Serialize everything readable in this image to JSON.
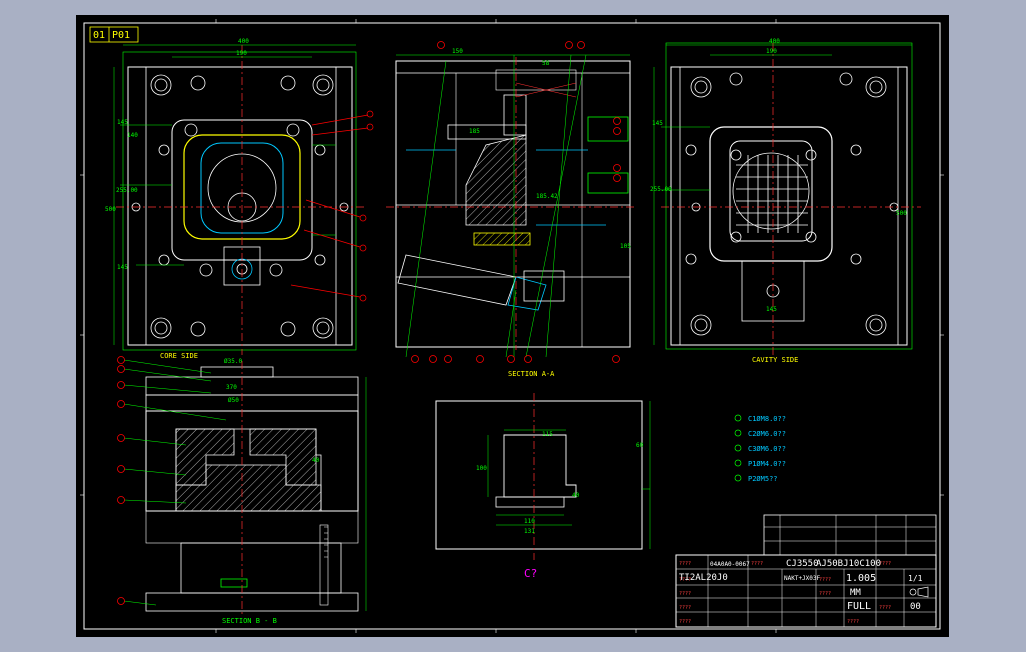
{
  "sheet": {
    "sheet_no": "01",
    "part_code": "P01"
  },
  "views": {
    "core_side": "CORE SIDE",
    "section_aa": "SECTION A-A",
    "cavity_side": "CAVITY SIDE",
    "section_bb": "SECTION B - B",
    "view_c": "C?"
  },
  "legend": [
    "C1ØM8.0??",
    "C2ØM6.0??",
    "C3ØM6.0??",
    "P1ØM4.0??",
    "P2ØM5??"
  ],
  "dimensions": {
    "core_width": "400",
    "core_half": "190",
    "core_left_a": "145",
    "core_left_b": "140",
    "core_center": "255.00",
    "core_height": "500",
    "core_low": "145",
    "aa_top": "150",
    "aa_mid": "185",
    "aa_slide": "185.42",
    "aa_a": "58",
    "aa_b": "105",
    "cavity_width": "400",
    "cavity_half": "190",
    "cavity_left": "145",
    "cavity_center": "255.00",
    "cavity_height": "500",
    "cavity_low": "145",
    "bb_top": "Ø35.0",
    "bb_mid": "Ø50",
    "bb_len": "370",
    "bb_side": "40",
    "c_width": "115",
    "c_height": "100",
    "c_a": "110",
    "c_b": "131",
    "c_c": "60",
    "c_d": "40"
  },
  "title_block": {
    "project_no": "CJ3550",
    "mold_no": "AJ50BJ10C100",
    "part_no": "04A0A0-0067",
    "drawing_no": "TI2AL20J0",
    "material": "NAKT+JX03F",
    "scale": "1.005",
    "unit": "MM",
    "size": "FULL",
    "sheet": "1/1",
    "rev": "00",
    "placeholder": "????"
  },
  "colors": {
    "background": "#000000",
    "frame": "#ffffff",
    "outline": "#ffffff",
    "dimension": "#00ff00",
    "centerline": "#ff3030",
    "balloon": "#ff0000",
    "cyan": "#00c8ff",
    "yellow": "#ffff00",
    "magenta": "#ff00ff"
  }
}
